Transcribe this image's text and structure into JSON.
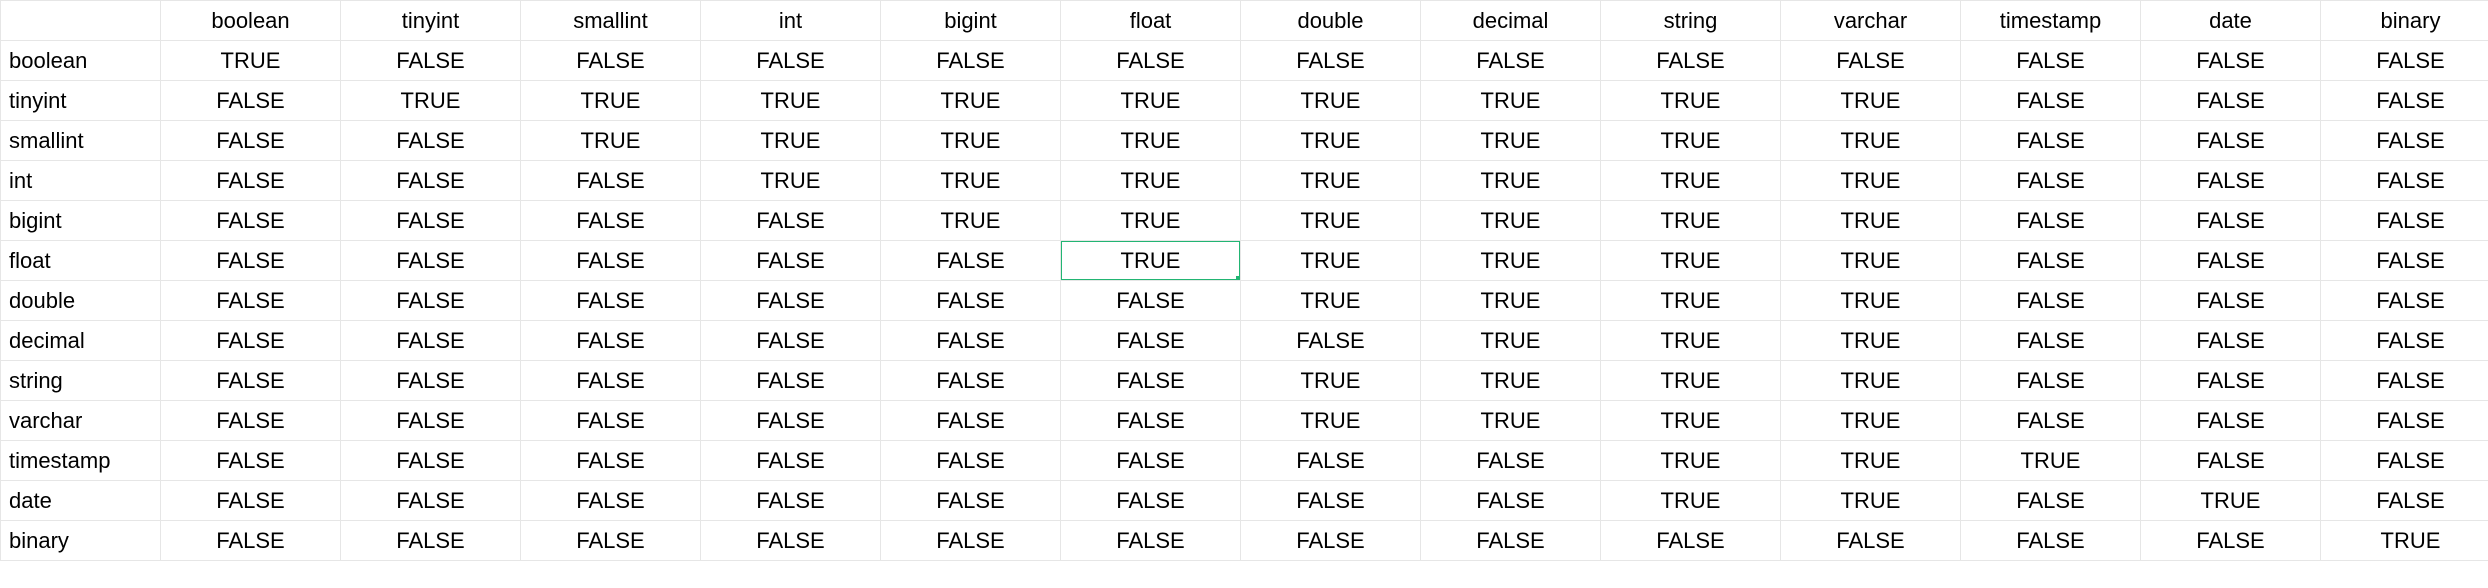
{
  "chart_data": {
    "type": "table",
    "columns": [
      "boolean",
      "tinyint",
      "smallint",
      "int",
      "bigint",
      "float",
      "double",
      "decimal",
      "string",
      "varchar",
      "timestamp",
      "date",
      "binary"
    ],
    "rows": [
      "boolean",
      "tinyint",
      "smallint",
      "int",
      "bigint",
      "float",
      "double",
      "decimal",
      "string",
      "varchar",
      "timestamp",
      "date",
      "binary"
    ],
    "values": [
      [
        "TRUE",
        "FALSE",
        "FALSE",
        "FALSE",
        "FALSE",
        "FALSE",
        "FALSE",
        "FALSE",
        "FALSE",
        "FALSE",
        "FALSE",
        "FALSE",
        "FALSE"
      ],
      [
        "FALSE",
        "TRUE",
        "TRUE",
        "TRUE",
        "TRUE",
        "TRUE",
        "TRUE",
        "TRUE",
        "TRUE",
        "TRUE",
        "FALSE",
        "FALSE",
        "FALSE"
      ],
      [
        "FALSE",
        "FALSE",
        "TRUE",
        "TRUE",
        "TRUE",
        "TRUE",
        "TRUE",
        "TRUE",
        "TRUE",
        "TRUE",
        "FALSE",
        "FALSE",
        "FALSE"
      ],
      [
        "FALSE",
        "FALSE",
        "FALSE",
        "TRUE",
        "TRUE",
        "TRUE",
        "TRUE",
        "TRUE",
        "TRUE",
        "TRUE",
        "FALSE",
        "FALSE",
        "FALSE"
      ],
      [
        "FALSE",
        "FALSE",
        "FALSE",
        "FALSE",
        "TRUE",
        "TRUE",
        "TRUE",
        "TRUE",
        "TRUE",
        "TRUE",
        "FALSE",
        "FALSE",
        "FALSE"
      ],
      [
        "FALSE",
        "FALSE",
        "FALSE",
        "FALSE",
        "FALSE",
        "TRUE",
        "TRUE",
        "TRUE",
        "TRUE",
        "TRUE",
        "FALSE",
        "FALSE",
        "FALSE"
      ],
      [
        "FALSE",
        "FALSE",
        "FALSE",
        "FALSE",
        "FALSE",
        "FALSE",
        "TRUE",
        "TRUE",
        "TRUE",
        "TRUE",
        "FALSE",
        "FALSE",
        "FALSE"
      ],
      [
        "FALSE",
        "FALSE",
        "FALSE",
        "FALSE",
        "FALSE",
        "FALSE",
        "FALSE",
        "TRUE",
        "TRUE",
        "TRUE",
        "FALSE",
        "FALSE",
        "FALSE"
      ],
      [
        "FALSE",
        "FALSE",
        "FALSE",
        "FALSE",
        "FALSE",
        "FALSE",
        "TRUE",
        "TRUE",
        "TRUE",
        "TRUE",
        "FALSE",
        "FALSE",
        "FALSE"
      ],
      [
        "FALSE",
        "FALSE",
        "FALSE",
        "FALSE",
        "FALSE",
        "FALSE",
        "TRUE",
        "TRUE",
        "TRUE",
        "TRUE",
        "FALSE",
        "FALSE",
        "FALSE"
      ],
      [
        "FALSE",
        "FALSE",
        "FALSE",
        "FALSE",
        "FALSE",
        "FALSE",
        "FALSE",
        "FALSE",
        "TRUE",
        "TRUE",
        "TRUE",
        "FALSE",
        "FALSE"
      ],
      [
        "FALSE",
        "FALSE",
        "FALSE",
        "FALSE",
        "FALSE",
        "FALSE",
        "FALSE",
        "FALSE",
        "TRUE",
        "TRUE",
        "FALSE",
        "TRUE",
        "FALSE"
      ],
      [
        "FALSE",
        "FALSE",
        "FALSE",
        "FALSE",
        "FALSE",
        "FALSE",
        "FALSE",
        "FALSE",
        "FALSE",
        "FALSE",
        "FALSE",
        "FALSE",
        "TRUE"
      ]
    ],
    "selected_cell": {
      "row": 5,
      "col": 5
    }
  }
}
